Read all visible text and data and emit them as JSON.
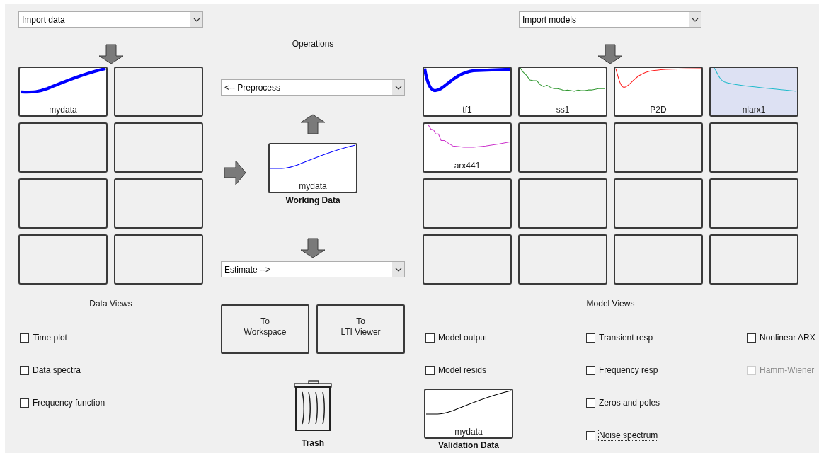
{
  "data_panel": {
    "import_dropdown": {
      "value": "Import data"
    },
    "boards": [
      {
        "kind": "rising",
        "label": "mydata",
        "color": "#0000ff",
        "active": true,
        "highlighted": false
      },
      {
        "kind": "empty"
      },
      {
        "kind": "empty"
      },
      {
        "kind": "empty"
      },
      {
        "kind": "empty"
      },
      {
        "kind": "empty"
      },
      {
        "kind": "empty"
      },
      {
        "kind": "empty"
      }
    ],
    "views_title": "Data Views",
    "views": [
      {
        "label": "Time plot",
        "checked": false
      },
      {
        "label": "Data spectra",
        "checked": false
      },
      {
        "label": "Frequency function",
        "checked": false
      }
    ]
  },
  "operations": {
    "title": "Operations",
    "preprocess_dropdown": {
      "value": "<-- Preprocess"
    },
    "working_data": {
      "kind": "rising",
      "label": "mydata",
      "color": "#0000ff",
      "caption": "Working Data"
    },
    "estimate_dropdown": {
      "value": "Estimate -->"
    },
    "buttons": [
      {
        "lines": [
          "To",
          "Workspace"
        ]
      },
      {
        "lines": [
          "To",
          "LTI Viewer"
        ]
      }
    ],
    "trash": {
      "label": "Trash"
    }
  },
  "model_panel": {
    "import_dropdown": {
      "value": "Import models"
    },
    "boards": [
      {
        "kind": "undershoot",
        "label": "tf1",
        "color": "#0000ff",
        "active": true,
        "highlighted": false
      },
      {
        "kind": "noisy-decay",
        "label": "ss1",
        "color": "#339933",
        "active": false,
        "highlighted": false
      },
      {
        "kind": "sharp-undershoot",
        "label": "P2D",
        "color": "#ff2020",
        "active": false,
        "highlighted": false
      },
      {
        "kind": "decay",
        "label": "nlarx1",
        "color": "#22bbcc",
        "active": false,
        "highlighted": true
      },
      {
        "kind": "staircase",
        "label": "arx441",
        "color": "#cc33cc",
        "active": false,
        "highlighted": false
      },
      {
        "kind": "empty"
      },
      {
        "kind": "empty"
      },
      {
        "kind": "empty"
      },
      {
        "kind": "empty"
      },
      {
        "kind": "empty"
      },
      {
        "kind": "empty"
      },
      {
        "kind": "empty"
      },
      {
        "kind": "empty"
      },
      {
        "kind": "empty"
      },
      {
        "kind": "empty"
      },
      {
        "kind": "empty"
      }
    ],
    "views_title": "Model Views",
    "view_columns": [
      {
        "items": [
          {
            "label": "Model output",
            "checked": false
          },
          {
            "label": "Model resids",
            "checked": false
          }
        ]
      },
      {
        "items": [
          {
            "label": "Transient resp",
            "checked": false
          },
          {
            "label": "Frequency resp",
            "checked": false
          },
          {
            "label": "Zeros and poles",
            "checked": false
          },
          {
            "label": "Noise spectrum",
            "checked": false,
            "focused": true
          }
        ]
      },
      {
        "items": [
          {
            "label": "Nonlinear ARX",
            "checked": false
          },
          {
            "label": "Hamm-Wiener",
            "checked": false,
            "disabled": true
          }
        ]
      }
    ],
    "validation_data": {
      "kind": "rising",
      "label": "mydata",
      "color": "#000000",
      "caption": "Validation Data"
    }
  }
}
